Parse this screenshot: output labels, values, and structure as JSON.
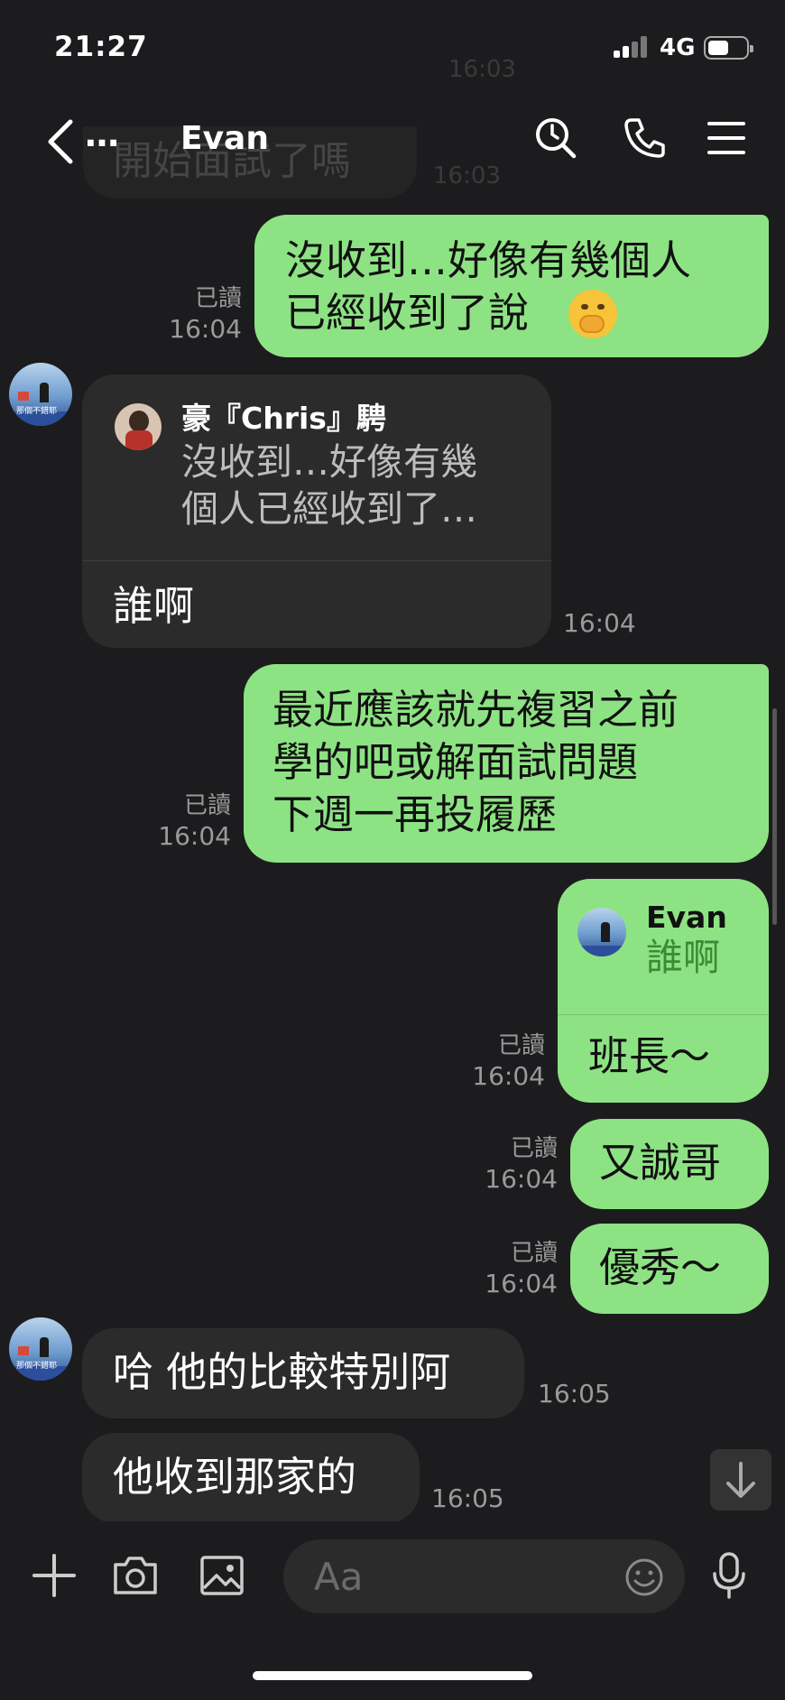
{
  "status": {
    "time": "21:27",
    "network": "4G"
  },
  "nav": {
    "title": "Evan",
    "overflow": "…"
  },
  "ghost": {
    "text": "開始面試了嗎",
    "time_top": "16:03",
    "time_mid": "16:03"
  },
  "messages": {
    "m1": {
      "lines": [
        "沒收到…好像有幾個人",
        "已經收到了說"
      ],
      "emoji": "🫢",
      "read": "已讀",
      "time": "16:04"
    },
    "m2": {
      "quote_name": "豪『Chris』騁",
      "quote_lines": [
        "沒收到…好像有幾",
        "個人已經收到了…"
      ],
      "text": "誰啊",
      "time": "16:04"
    },
    "m3": {
      "lines": [
        "最近應該就先複習之前",
        "學的吧或解面試問題",
        "下週一再投履歷"
      ],
      "read": "已讀",
      "time": "16:04"
    },
    "m4": {
      "quote_name": "Evan",
      "quote_text": "誰啊",
      "text": "班長～",
      "read": "已讀",
      "time": "16:04"
    },
    "m5": {
      "text": "又誠哥",
      "read": "已讀",
      "time": "16:04"
    },
    "m6": {
      "text": "優秀～",
      "read": "已讀",
      "time": "16:04"
    },
    "m7": {
      "text": "哈 他的比較特別阿",
      "time": "16:05"
    },
    "m8": {
      "text": "他收到那家的",
      "time": "16:05"
    }
  },
  "input": {
    "placeholder": "Aa"
  },
  "icons": [
    "back-icon",
    "search-icon",
    "phone-icon",
    "menu-icon",
    "plus-icon",
    "camera-icon",
    "image-icon",
    "emoji-icon",
    "mic-icon",
    "arrow-down-icon"
  ]
}
